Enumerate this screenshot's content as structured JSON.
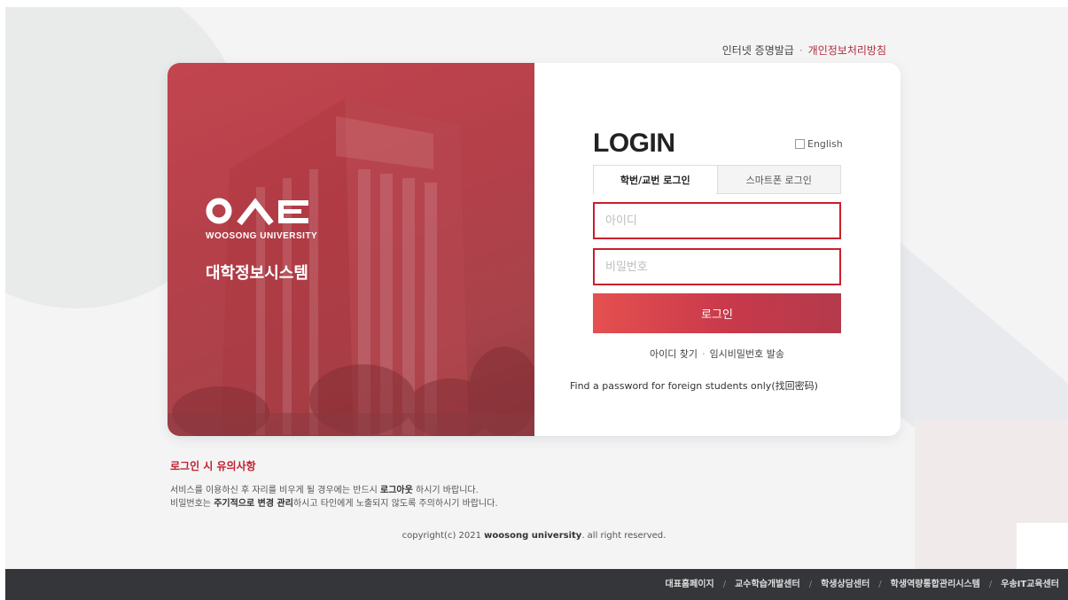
{
  "top_links": {
    "certificate": "인터넷 증명발급",
    "separator": "·",
    "privacy": "개인정보처리방침"
  },
  "brand": {
    "logo_text": "O∧C",
    "university": "WOOSONG UNIVERSITY",
    "system_name": "대학정보시스템"
  },
  "login": {
    "title": "LOGIN",
    "english_label": "English",
    "tabs": [
      {
        "label": "학번/교번 로그인",
        "active": true
      },
      {
        "label": "스마트폰 로그인",
        "active": false
      }
    ],
    "id_placeholder": "아이디",
    "password_placeholder": "비밀번호",
    "submit_label": "로그인",
    "find_id": "아이디 찾기",
    "find_separator": "·",
    "temp_password": "임시비밀번호 발송",
    "foreign_password": "Find a password for foreign students only(找回密码)"
  },
  "notice": {
    "title": "로그인 시 유의사항",
    "line1_a": "서비스를 이용하신 후 자리를 비우게 될 경우에는 반드시 ",
    "line1_b": "로그아웃",
    "line1_c": " 하시기 바랍니다.",
    "line2_a": "비밀번호는 ",
    "line2_b": "주기적으로 변경 관리",
    "line2_c": "하시고 타인에게 노출되지 않도록 주의하시기 바랍니다."
  },
  "copyright": {
    "prefix": "copyright(c) 2021 ",
    "name": "woosong university",
    "suffix": ". all right reserved."
  },
  "footer": {
    "links": [
      "대표홈페이지",
      "교수학습개발센터",
      "학생상담센터",
      "학생역량통합관리시스템",
      "우송IT교육센터"
    ],
    "separator": "/"
  },
  "colors": {
    "accent": "#c9202b",
    "brand_red": "#b5404a",
    "footer_bg": "#35363a"
  }
}
